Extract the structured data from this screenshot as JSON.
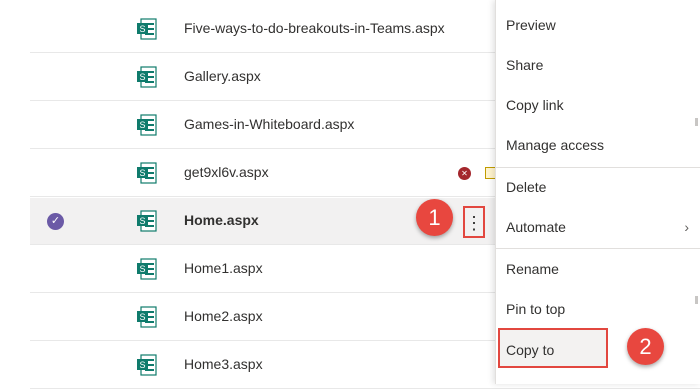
{
  "files": [
    {
      "name": "Five-ways-to-do-breakouts-in-Teams.aspx",
      "selected": false
    },
    {
      "name": "Gallery.aspx",
      "selected": false
    },
    {
      "name": "Games-in-Whiteboard.aspx",
      "selected": false
    },
    {
      "name": "get9xl6v.aspx",
      "selected": false,
      "status_icons": [
        "error-icon",
        "checked-out-icon"
      ]
    },
    {
      "name": "Home.aspx",
      "selected": true
    },
    {
      "name": "Home1.aspx",
      "selected": false
    },
    {
      "name": "Home2.aspx",
      "selected": false
    },
    {
      "name": "Home3.aspx",
      "selected": false
    }
  ],
  "more_button": {
    "glyph": "⋮",
    "icon": "more-vertical-icon"
  },
  "check_glyph": "✓",
  "context_menu": {
    "items": [
      {
        "label": "Preview"
      },
      {
        "label": "Share"
      },
      {
        "label": "Copy link"
      },
      {
        "label": "Manage access"
      },
      {
        "label": "Delete"
      },
      {
        "label": "Automate",
        "submenu": true
      },
      {
        "label": "Rename"
      },
      {
        "label": "Pin to top"
      },
      {
        "label": "Copy to"
      }
    ],
    "chevron": "›",
    "highlighted": "Copy to"
  },
  "callouts": [
    {
      "label": "1"
    },
    {
      "label": "2"
    }
  ],
  "colors": {
    "callout": "#e8473f",
    "highlight_border": "#e2473f",
    "sharepoint_icon": "#0f7b6c",
    "selected_check": "#6b5aa6"
  }
}
